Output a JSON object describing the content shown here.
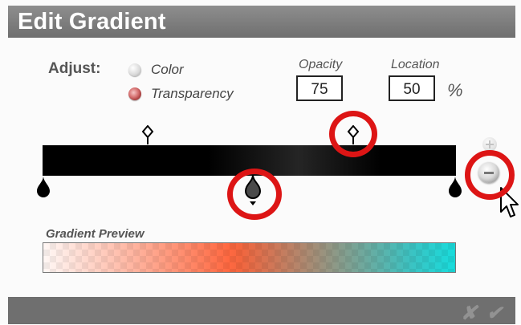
{
  "window": {
    "title": "Edit Gradient"
  },
  "adjust": {
    "label": "Adjust:",
    "options": [
      {
        "label": "Color",
        "selected": false
      },
      {
        "label": "Transparency",
        "selected": true
      }
    ]
  },
  "opacity": {
    "label": "Opacity",
    "value": "75"
  },
  "location": {
    "label": "Location",
    "value": "50",
    "unit": "%"
  },
  "gradient_bar": {
    "colors": [
      "#000000",
      "#252525"
    ]
  },
  "preview": {
    "label": "Gradient Preview",
    "colors": [
      "#ffffff",
      "#ff6a3f",
      "#18dcdc"
    ]
  },
  "highlights": {
    "color": "#dd1515"
  },
  "footer": {
    "cancel_icon": "cancel-icon",
    "confirm_icon": "checkmark-icon"
  }
}
